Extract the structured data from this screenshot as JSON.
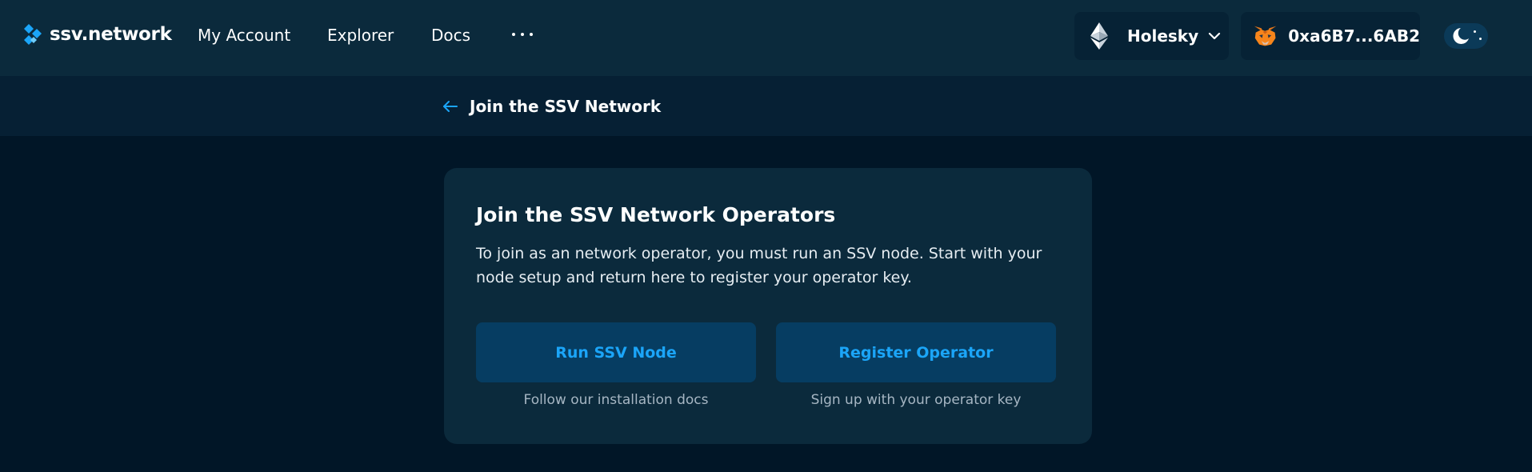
{
  "header": {
    "brand": "ssv.network",
    "nav": [
      {
        "label": "My Account"
      },
      {
        "label": "Explorer"
      },
      {
        "label": "Docs"
      }
    ],
    "more_icon": "ellipsis-icon",
    "network": {
      "label": "Holesky",
      "icon": "ethereum-icon"
    },
    "wallet": {
      "label": "0xa6B7...6AB2",
      "icon": "metamask-fox-icon"
    },
    "theme_toggle": {
      "icon": "moon-icon"
    }
  },
  "subheader": {
    "back_icon": "arrow-left-icon",
    "title": "Join the SSV Network"
  },
  "card": {
    "title": "Join the SSV Network Operators",
    "description": "To join as an network operator, you must run an SSV node. Start with your node setup and return here to register your operator key.",
    "actions": [
      {
        "label": "Run SSV Node",
        "hint": "Follow our installation docs"
      },
      {
        "label": "Register Operator",
        "hint": "Sign up with your operator key"
      }
    ]
  },
  "colors": {
    "page_background": "#011627",
    "header_background": "#0b2a3c",
    "card_background": "#0b2a3c",
    "button_background": "#063d62",
    "accent": "#1ba5f8",
    "text_primary": "#fdfefe",
    "text_muted": "#a6b6c3"
  }
}
